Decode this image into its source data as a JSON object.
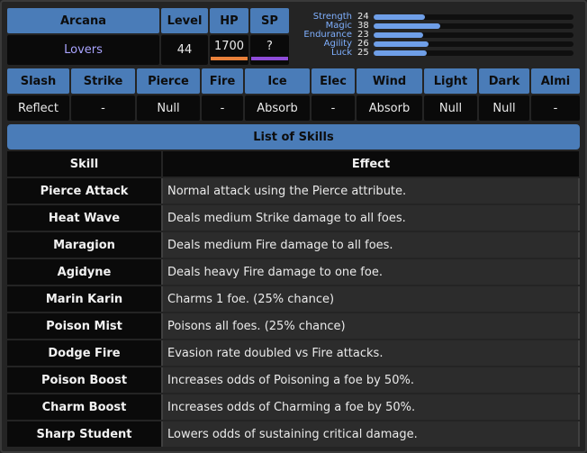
{
  "persona": {
    "arcana_label": "Arcana",
    "arcana_value": "Lovers",
    "level_label": "Level",
    "level_value": "44",
    "hp_label": "HP",
    "hp_value": "1700",
    "sp_label": "SP",
    "sp_value": "?"
  },
  "stats": [
    {
      "name": "Strength",
      "value": "24",
      "fraction": 0.24
    },
    {
      "name": "Magic",
      "value": "38",
      "fraction": 0.38
    },
    {
      "name": "Endurance",
      "value": "23",
      "fraction": 0.23
    },
    {
      "name": "Agility",
      "value": "26",
      "fraction": 0.26
    },
    {
      "name": "Luck",
      "value": "25",
      "fraction": 0.25
    }
  ],
  "affinities": [
    {
      "type": "Slash",
      "value": "Reflect"
    },
    {
      "type": "Strike",
      "value": "-"
    },
    {
      "type": "Pierce",
      "value": "Null"
    },
    {
      "type": "Fire",
      "value": "-"
    },
    {
      "type": "Ice",
      "value": "Absorb"
    },
    {
      "type": "Elec",
      "value": "-"
    },
    {
      "type": "Wind",
      "value": "Absorb"
    },
    {
      "type": "Light",
      "value": "Null"
    },
    {
      "type": "Dark",
      "value": "Null"
    },
    {
      "type": "Almi",
      "value": "-"
    }
  ],
  "skills": {
    "title": "List of Skills",
    "col_skill": "Skill",
    "col_effect": "Effect",
    "rows": [
      {
        "name": "Pierce Attack",
        "effect": "Normal attack using the Pierce attribute."
      },
      {
        "name": "Heat Wave",
        "effect": "Deals medium Strike damage to all foes."
      },
      {
        "name": "Maragion",
        "effect": "Deals medium Fire damage to all foes."
      },
      {
        "name": "Agidyne",
        "effect": "Deals heavy Fire damage to one foe."
      },
      {
        "name": "Marin Karin",
        "effect": "Charms 1 foe. (25% chance)"
      },
      {
        "name": "Poison Mist",
        "effect": "Poisons all foes. (25% chance)"
      },
      {
        "name": "Dodge Fire",
        "effect": "Evasion rate doubled vs Fire attacks."
      },
      {
        "name": "Poison Boost",
        "effect": "Increases odds of Poisoning a foe by 50%."
      },
      {
        "name": "Charm Boost",
        "effect": "Increases odds of Charming a foe by 50%."
      },
      {
        "name": "Sharp Student",
        "effect": "Lowers odds of sustaining critical damage."
      }
    ]
  },
  "colors": {
    "header_blue": "#4a7cb8",
    "lovers_text": "#a9a4ff",
    "hp_bar": "#e8803a",
    "sp_bar": "#8e4cd8",
    "stat_bar": "#6f9fe8"
  }
}
